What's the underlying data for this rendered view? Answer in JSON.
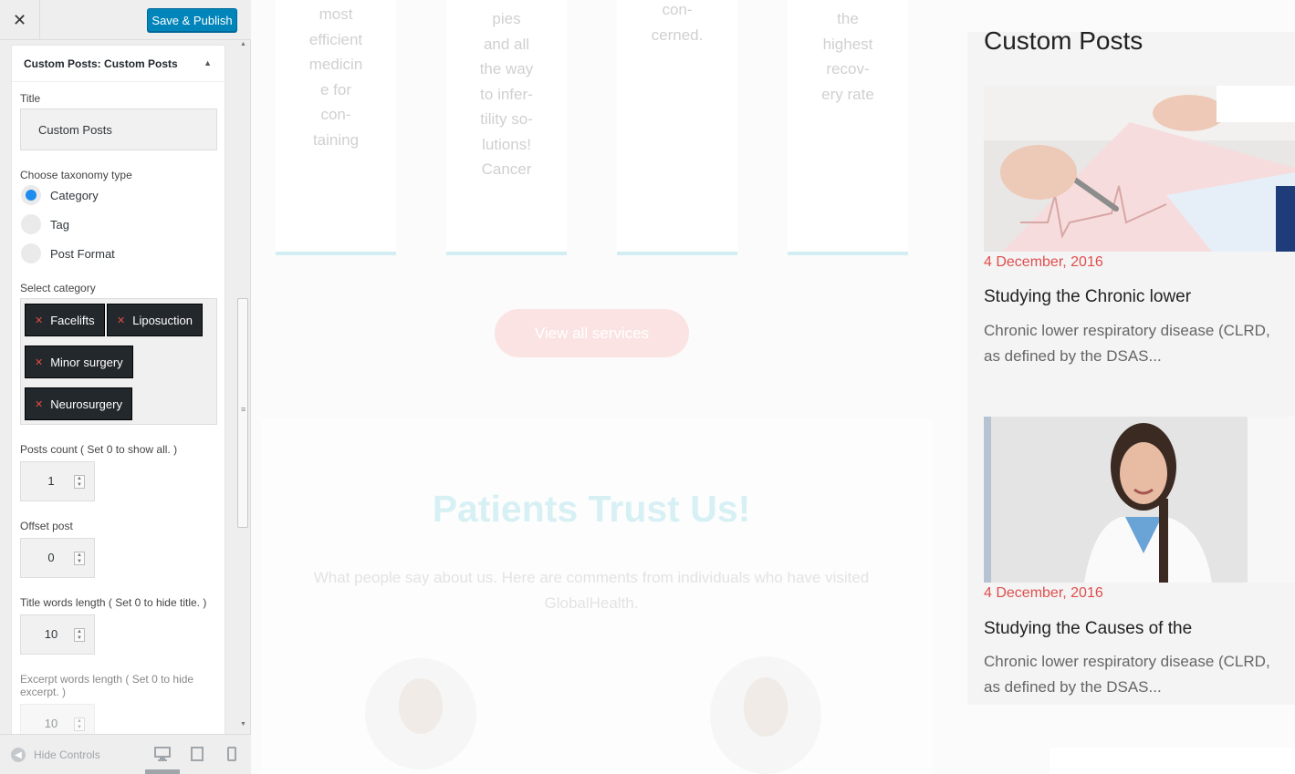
{
  "header": {
    "close_label": "✕",
    "publish_label": "Save & Publish"
  },
  "widget": {
    "title_prefix": "Custom Posts:",
    "title_name": "Custom Posts",
    "collapse_icon": "▲",
    "title_label": "Title",
    "title_value": "Custom Posts",
    "taxonomy_label": "Choose taxonomy type",
    "taxonomy_options": [
      {
        "label": "Category",
        "checked": true
      },
      {
        "label": "Tag",
        "checked": false
      },
      {
        "label": "Post Format",
        "checked": false
      }
    ],
    "category_label": "Select category",
    "categories": [
      "Facelifts",
      "Liposuction",
      "Minor surgery",
      "Neurosurgery"
    ],
    "remove_icon": "✕",
    "posts_count_label": "Posts count ( Set 0 to show all. )",
    "posts_count_value": "1",
    "offset_label": "Offset post",
    "offset_value": "0",
    "title_words_label": "Title words length ( Set 0 to hide title. )",
    "title_words_value": "10",
    "excerpt_words_label": "Excerpt words length ( Set 0 to hide excerpt. )",
    "excerpt_words_value": "10"
  },
  "footer": {
    "hide_controls_label": "Hide Controls",
    "device_icons": [
      "desktop-icon",
      "tablet-icon",
      "mobile-icon"
    ]
  },
  "preview": {
    "service_texts": [
      [
        "most",
        "efficient",
        "medicin",
        "e for",
        "con-",
        "taining"
      ],
      [
        "pies",
        "and all",
        "the way",
        "to infer-",
        "tility so-",
        "lutions!",
        "Cancer"
      ],
      [
        "con-",
        "cerned."
      ],
      [
        "the",
        "highest",
        "recov-",
        "ery rate"
      ]
    ],
    "view_all_label": "View all services",
    "trust_title": "Patients Trust Us!",
    "trust_sub": "What people say about us. Here are comments from individuals who have visited GlobalHealth."
  },
  "sidebar": {
    "title": "Custom Posts",
    "posts": [
      {
        "date": "4 December, 2016",
        "title": "Studying the Chronic lower",
        "excerpt": "Chronic lower respiratory disease (CLRD, as defined by the DSAS..."
      },
      {
        "date": "4 December, 2016",
        "title": "Studying the Causes of the",
        "excerpt": "Chronic lower respiratory disease (CLRD, as defined by the DSAS..."
      }
    ]
  },
  "colors": {
    "accent": "#0085ba",
    "date_red": "#e04e4e",
    "radio_checked": "#1e8cef"
  }
}
